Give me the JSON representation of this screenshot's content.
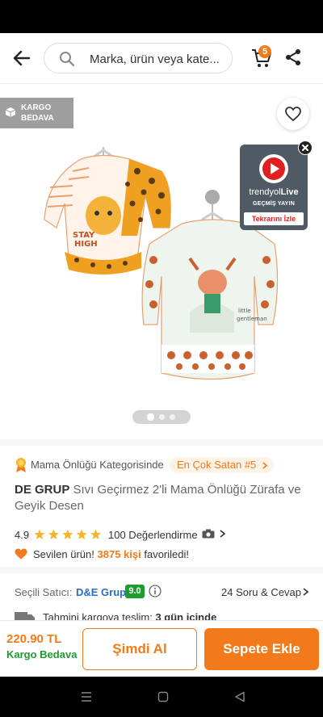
{
  "header": {
    "search_placeholder": "Marka, ürün veya kate...",
    "cart_count": "5"
  },
  "gallery": {
    "cargo_badge": "KARGO BEDAVA",
    "live": {
      "brand_prefix": "trendyol",
      "brand_suffix": "Live",
      "past_broadcast": "GEÇMİŞ YAYIN",
      "replay": "Tekrarını İzle"
    },
    "slide_count": 3,
    "active_slide": 1
  },
  "product": {
    "category_text": "Mama Önlüğü Kategorisinde",
    "best_seller": "En Çok Satan #5",
    "brand": "DE GRUP",
    "name": " Sıvı Geçirmez 2'li Mama Önlüğü Zürafa ve Geyik Desen",
    "rating": "4.9",
    "stars": 5,
    "reviews": "100 Değerlendirme",
    "favorite_prefix": "Sevilen ürün!",
    "favorite_count": "3875 kişi",
    "favorite_suffix": "favoriledi!"
  },
  "seller": {
    "label": "Seçili Satıcı:",
    "name": "D&E Grup",
    "score": "9.0",
    "qa": "24 Soru & Cevap",
    "delivery_label": "Tahmini kargoya teslim:",
    "delivery_value": "3 gün içinde"
  },
  "bottom": {
    "price": "220.90 TL",
    "cargo": "Kargo Bedava",
    "buy_now": "Şimdi Al",
    "add_to_cart": "Sepete Ekle"
  },
  "colors": {
    "accent": "#f27a1a",
    "green": "#1d9c2f",
    "link": "#2a6ec1",
    "live_bg": "#505a64"
  }
}
